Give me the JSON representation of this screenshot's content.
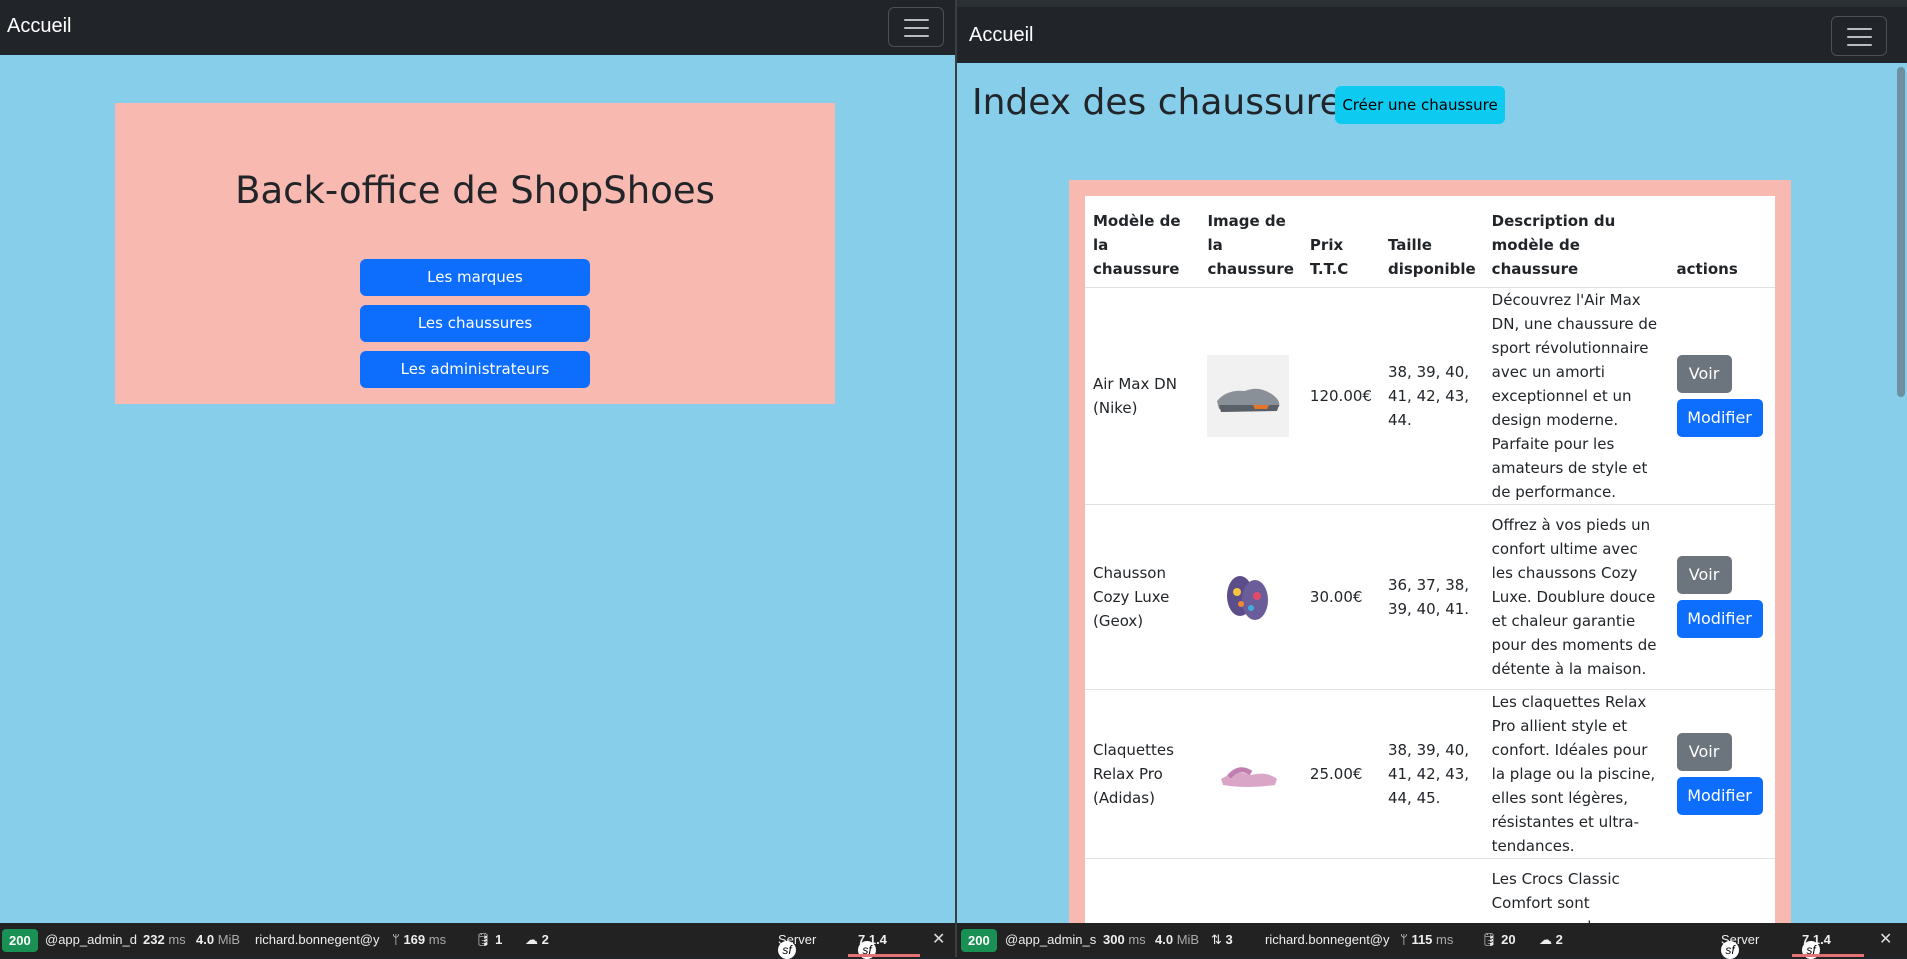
{
  "left": {
    "navbar": {
      "brand": "Accueil"
    },
    "hero": {
      "title": "Back-office de ShopShoes",
      "buttons": [
        "Les marques",
        "Les chaussures",
        "Les administrateurs"
      ]
    },
    "debug": {
      "status": "200",
      "route": "@app_admin_d",
      "time": "232",
      "time_unit": "ms",
      "memory": "4.0",
      "memory_unit": "MiB",
      "user": "richard.bonnegent@y",
      "twig_time": "169",
      "twig_unit": "ms",
      "db_count": "1",
      "upload_count": "2",
      "server_label": "Server",
      "version": "7.1.4"
    }
  },
  "right": {
    "navbar": {
      "brand": "Accueil"
    },
    "page_title": "Index des chaussures",
    "create_button": "Créer une chaussure",
    "table": {
      "headers": [
        "Modèle de la chaussure",
        "Image de la chaussure",
        "Prix T.T.C",
        "Taille disponible",
        "Description du modèle de chaussure",
        "actions"
      ],
      "rows": [
        {
          "model": "Air Max DN (Nike)",
          "price": "120.00€",
          "sizes": "38, 39, 40, 41, 42, 43, 44.",
          "description": "Découvrez l'Air Max DN, une chaussure de sport révolutionnaire avec un amorti exceptionnel et un design moderne. Parfaite pour les amateurs de style et de performance."
        },
        {
          "model": "Chausson Cozy Luxe (Geox)",
          "price": "30.00€",
          "sizes": "36, 37, 38, 39, 40, 41.",
          "description": "Offrez à vos pieds un confort ultime avec les chaussons Cozy Luxe. Doublure douce et chaleur garantie pour des moments de détente à la maison."
        },
        {
          "model": "Claquettes Relax Pro (Adidas)",
          "price": "25.00€",
          "sizes": "38, 39, 40, 41, 42, 43, 44, 45.",
          "description": "Les claquettes Relax Pro allient style et confort. Idéales pour la plage ou la piscine, elles sont légères, résistantes et ultra-tendances."
        },
        {
          "model": "",
          "price": "",
          "sizes": "",
          "description": "Les Crocs Classic Comfort sont synonymes de"
        }
      ],
      "view_label": "Voir",
      "edit_label": "Modifier"
    },
    "debug": {
      "status": "200",
      "route": "@app_admin_s",
      "time": "300",
      "time_unit": "ms",
      "memory": "4.0",
      "memory_unit": "MiB",
      "requests": "3",
      "user": "richard.bonnegent@y",
      "twig_time": "115",
      "twig_unit": "ms",
      "db_count": "20",
      "upload_count": "2",
      "server_label": "Server",
      "version": "7.1.4"
    }
  },
  "colors": {
    "background": "#87ceeb",
    "navbar": "#212529",
    "hero": "#f8b9b0",
    "primary": "#0d6efd",
    "info": "#0dcaf0",
    "secondary": "#6c757d",
    "status_ok": "#199154"
  }
}
